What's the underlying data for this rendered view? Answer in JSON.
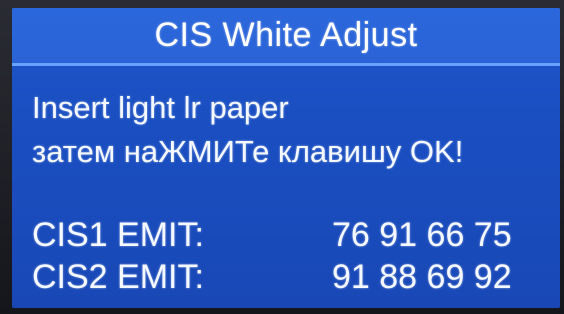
{
  "screen": {
    "title": "CIS White Adjust",
    "message_line1": "Insert light lr paper",
    "message_line2": "затем наЖМИТе клавишу OK!",
    "readings": [
      {
        "label": "CIS1 EMIT:",
        "values": "76 91 66 75"
      },
      {
        "label": "CIS2 EMIT:",
        "values": "91 88 69 92"
      }
    ]
  },
  "colors": {
    "screen_background": "#1a4fc2",
    "title_bar": "#2a63d6",
    "title_divider": "#6aa3ff",
    "text": "#ffffff"
  }
}
